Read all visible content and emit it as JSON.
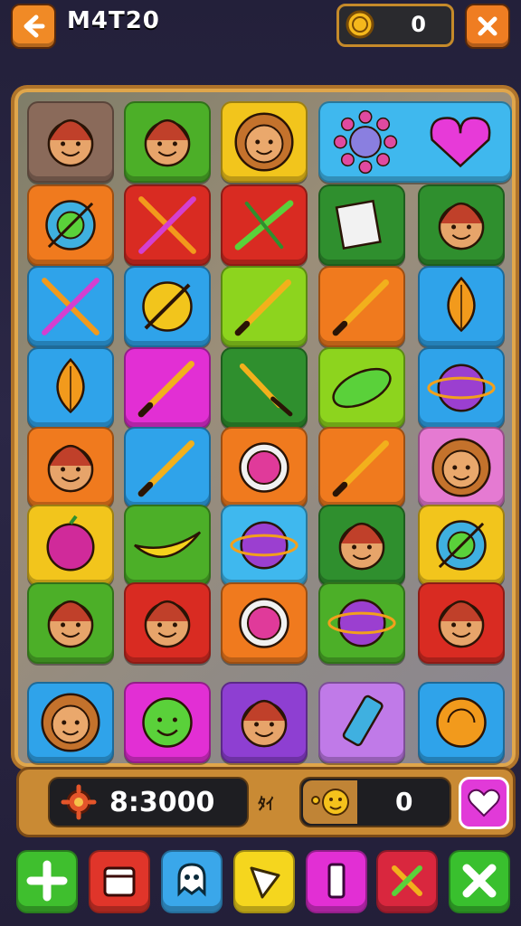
{
  "header": {
    "title": "M4T20",
    "coins": "0",
    "back_icon": "arrow-left-icon",
    "close_icon": "close-icon",
    "coin_icon": "coin-icon"
  },
  "board": {
    "colors": {
      "brown": "#8a6a5a",
      "green": "#4caf28",
      "yellow": "#f2c51c",
      "cyan": "#3fb8ee",
      "orange": "#f07a1e",
      "red": "#d92b22",
      "dkgreen": "#2f8f2e",
      "lime": "#8dd41e",
      "blue": "#2fa3ea",
      "magenta": "#e22fd4",
      "pink": "#e57ad2",
      "purple": "#8e3fd2",
      "lilac": "#c07ae8"
    },
    "rows": [
      [
        "brown:face-icon",
        "green:face-icon",
        "yellow:lion-face-icon",
        "cyan:flower-sun-icon",
        "cyan:heart-icon"
      ],
      [
        "orange:target-icon",
        "red:crossed-tools-icon",
        "red:wrench-icon",
        "dkgreen:paper-icon",
        "dkgreen:face-icon"
      ],
      [
        "blue:crossed-pencils-icon",
        "blue:smiley-pen-icon",
        "lime:pencil-icon",
        "orange:pencil-icon",
        "blue:leaf-icon"
      ],
      [
        "blue:leaf-icon",
        "magenta:pencil-icon",
        "dkgreen:brush-icon",
        "lime:orbit-icon",
        "blue:circle-icon"
      ],
      [
        "orange:face-icon",
        "blue:pencil-icon",
        "orange:clock-icon",
        "orange:pencil-icon",
        "pink:lion-face-icon"
      ],
      [
        "yellow:berry-icon",
        "green:banana-icon",
        "cyan:planet-icon",
        "dkgreen:face-icon",
        "yellow:target-icon"
      ],
      [
        "green:face-icon",
        "red:face-icon",
        "orange:clock-icon",
        "green:planet-icon",
        "red:face-icon"
      ],
      [
        "blue:lion-face-icon",
        "magenta:smiley-icon",
        "purple:face-icon",
        "lilac:crayon-icon",
        "blue:swirl-icon"
      ]
    ]
  },
  "footer": {
    "score": "8:3000",
    "mid_label": "ﾀｲ",
    "count": "0",
    "gear_icon": "gear-icon",
    "face_icon": "emoji-face-icon",
    "heart_icon": "heart-icon"
  },
  "toolbar": [
    {
      "name": "add-button",
      "icon": "plus-icon",
      "color": "#3fbf2e"
    },
    {
      "name": "calendar-button",
      "icon": "calendar-icon",
      "color": "#e0352a"
    },
    {
      "name": "ghost-button",
      "icon": "ghost-icon",
      "color": "#3aa7ea"
    },
    {
      "name": "play-button",
      "icon": "play-icon",
      "color": "#f5d61e"
    },
    {
      "name": "bookmark-button",
      "icon": "bookmark-icon",
      "color": "#e22fd4"
    },
    {
      "name": "tools-button",
      "icon": "crossed-tools-icon",
      "color": "#d9273e"
    },
    {
      "name": "close-button",
      "icon": "close-icon",
      "color": "#39c02e"
    }
  ]
}
